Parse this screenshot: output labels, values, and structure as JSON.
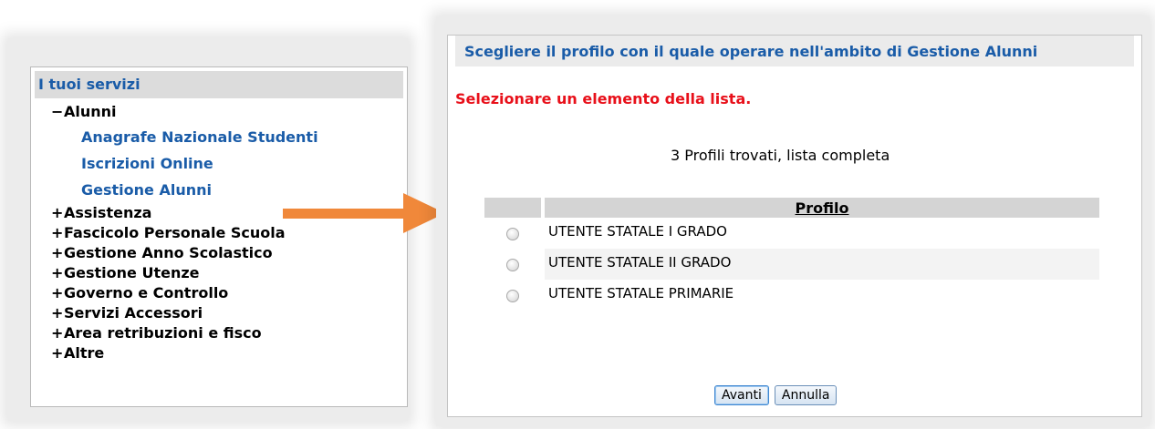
{
  "services_panel": {
    "title": "I tuoi servizi",
    "expanded_section": {
      "sign": "−",
      "label": "Alunni",
      "items": [
        {
          "label": "Anagrafe Nazionale Studenti"
        },
        {
          "label": "Iscrizioni Online"
        },
        {
          "label": "Gestione Alunni"
        }
      ]
    },
    "collapsed_sections": [
      {
        "sign": "+",
        "label": "Assistenza"
      },
      {
        "sign": "+",
        "label": "Fascicolo Personale Scuola"
      },
      {
        "sign": "+",
        "label": "Gestione Anno Scolastico"
      },
      {
        "sign": "+",
        "label": "Gestione Utenze"
      },
      {
        "sign": "+",
        "label": "Governo e Controllo"
      },
      {
        "sign": "+",
        "label": "Servizi Accessori"
      },
      {
        "sign": "+",
        "label": "Area retribuzioni e fisco"
      },
      {
        "sign": "+",
        "label": "Altre"
      }
    ]
  },
  "arrow": {
    "icon": "arrow-right-icon",
    "color": "#f0883a"
  },
  "profile_panel": {
    "header": "Scegliere il profilo con il quale operare nell'ambito di Gestione Alunni",
    "error": "Selezionare un elemento della lista.",
    "result_count": "3 Profili trovati, lista completa",
    "table": {
      "column_header": "Profilo",
      "rows": [
        {
          "name": "UTENTE STATALE I GRADO",
          "selected": false
        },
        {
          "name": "UTENTE STATALE II GRADO",
          "selected": false
        },
        {
          "name": "UTENTE STATALE PRIMARIE",
          "selected": false
        }
      ]
    },
    "buttons": {
      "next": "Avanti",
      "cancel": "Annulla"
    }
  },
  "colors": {
    "link": "#1a5ca8",
    "error": "#e8101a",
    "arrow": "#f0883a"
  }
}
